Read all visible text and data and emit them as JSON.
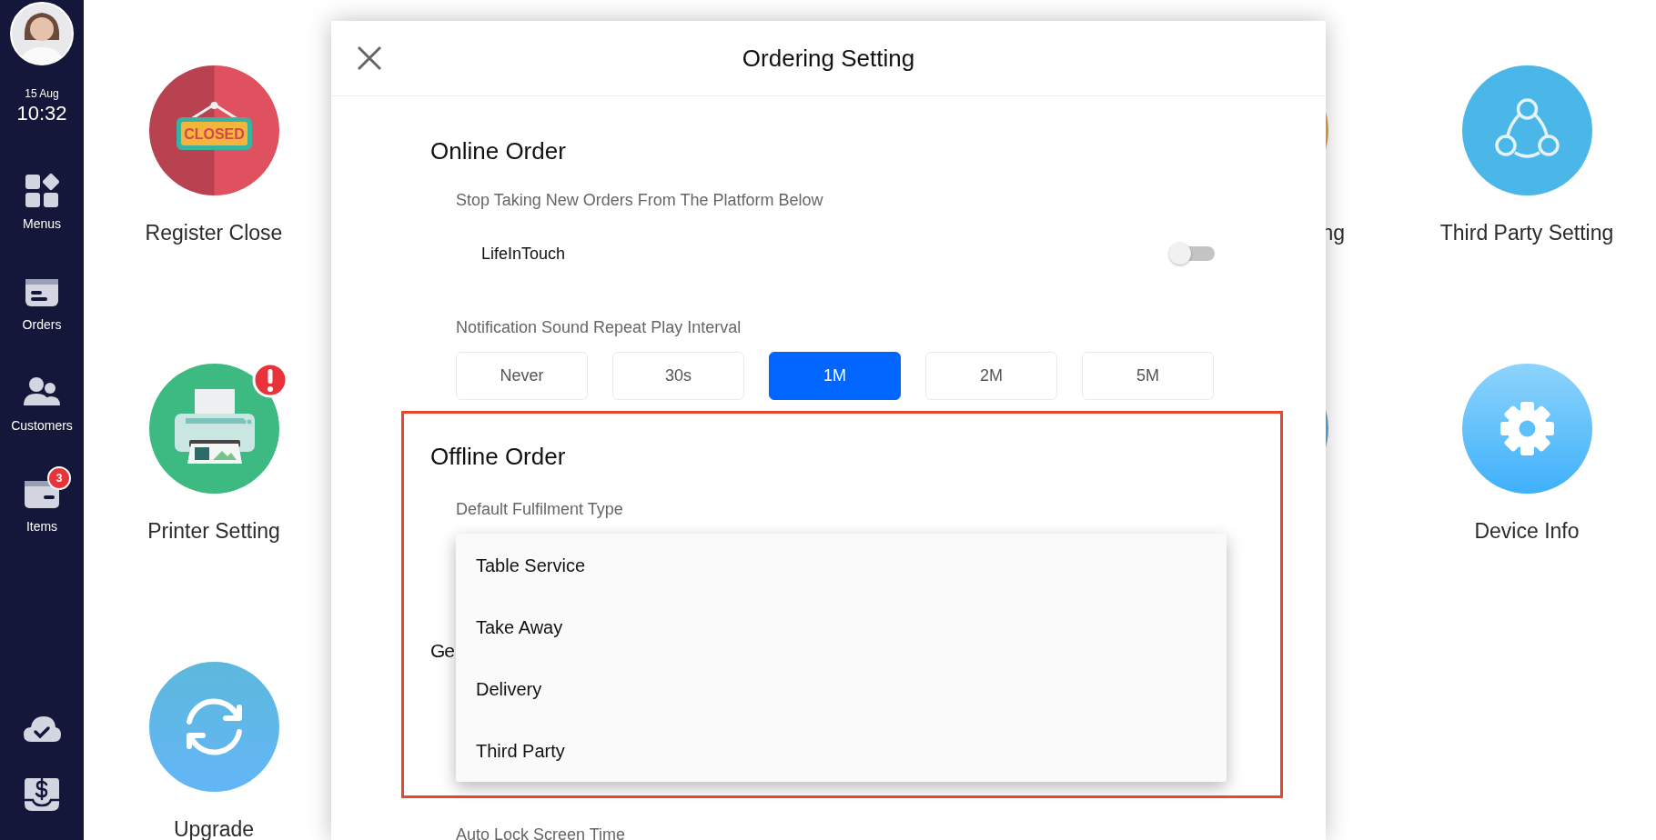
{
  "sidebar": {
    "date": "15 Aug",
    "time": "10:32",
    "items": [
      {
        "kind": "menus",
        "label": "Menus"
      },
      {
        "kind": "orders",
        "label": "Orders"
      },
      {
        "kind": "customers",
        "label": "Customers"
      },
      {
        "kind": "items",
        "label": "Items",
        "badge": "3"
      }
    ],
    "bottom_icons": [
      {
        "kind": "cloud"
      },
      {
        "kind": "cash"
      }
    ]
  },
  "tile_columns": [
    [
      {
        "kind": "register-close",
        "label": "Register Close",
        "sign_text": "CLOSED"
      },
      {
        "kind": "printer",
        "label": "Printer Setting",
        "alert": true
      },
      {
        "kind": "upgrade",
        "label": "Upgrade"
      }
    ],
    [
      {
        "kind": "partial-orange",
        "label": "ng"
      },
      {
        "kind": "partial-blue"
      }
    ],
    [
      {
        "kind": "third-party",
        "label": "Third Party Setting"
      },
      {
        "kind": "device-info",
        "label": "Device Info"
      }
    ]
  ],
  "modal": {
    "title": "Ordering Setting",
    "online_order": {
      "heading": "Online Order",
      "platforms_label": "Stop Taking New Orders From The Platform Below",
      "platforms": [
        {
          "name": "LifeInTouch",
          "on": false
        }
      ],
      "interval_label": "Notification Sound Repeat Play Interval",
      "intervals": [
        {
          "label": "Never",
          "selected": false
        },
        {
          "label": "30s",
          "selected": false
        },
        {
          "label": "1M",
          "selected": true
        },
        {
          "label": "2M",
          "selected": false
        },
        {
          "label": "5M",
          "selected": false
        }
      ]
    },
    "offline_order": {
      "heading": "Offline Order",
      "fulfilment_label": "Default Fulfilment Type",
      "dropdown_options": [
        {
          "label": "Table Service"
        },
        {
          "label": "Take Away"
        },
        {
          "label": "Delivery"
        },
        {
          "label": "Third Party"
        }
      ]
    },
    "general": {
      "heading": "Ge",
      "auto_lock_label": "Auto Lock Screen Time"
    }
  },
  "highlight": true
}
